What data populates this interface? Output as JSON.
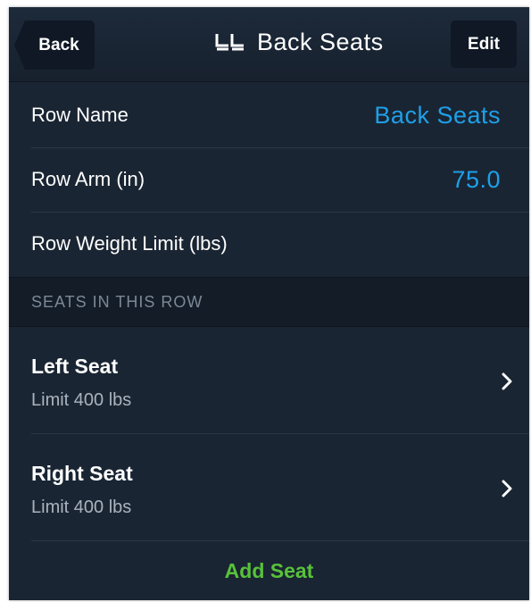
{
  "navbar": {
    "back_label": "Back",
    "title": "Back Seats",
    "title_icon": "seat-row-icon",
    "edit_label": "Edit"
  },
  "fields": [
    {
      "label": "Row Name",
      "value": "Back Seats"
    },
    {
      "label": "Row Arm (in)",
      "value": "75.0"
    },
    {
      "label": "Row Weight Limit (lbs)",
      "value": ""
    }
  ],
  "section": {
    "header": "SEATS IN THIS ROW"
  },
  "seats": [
    {
      "name": "Left Seat",
      "limit": "Limit 400 lbs"
    },
    {
      "name": "Right Seat",
      "limit": "Limit 400 lbs"
    }
  ],
  "add_seat_label": "Add Seat",
  "colors": {
    "background": "#1a2533",
    "value_blue": "#1ea0e8",
    "add_green": "#58c23a",
    "section_text": "#7c8896"
  }
}
